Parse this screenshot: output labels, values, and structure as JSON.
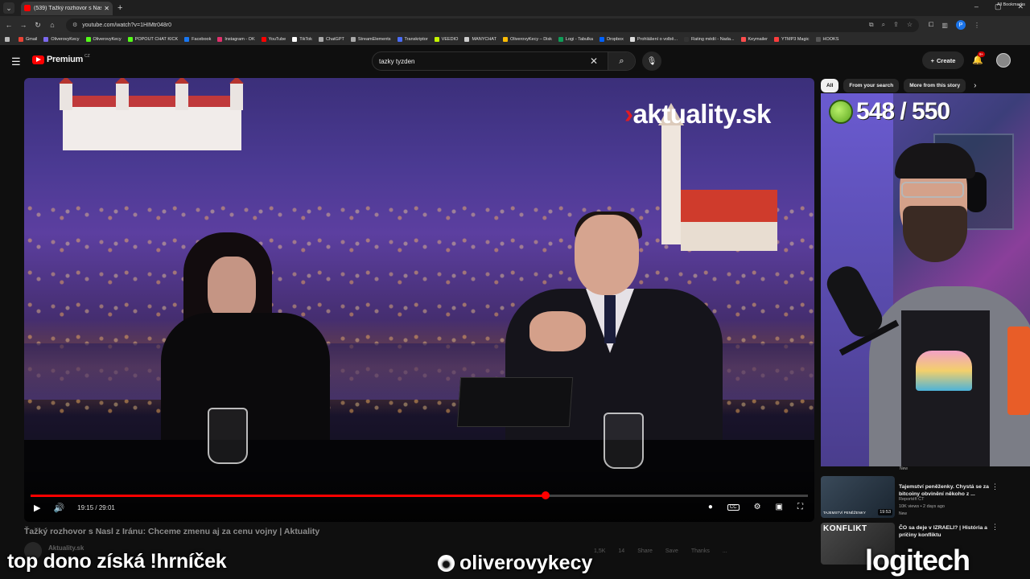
{
  "browser": {
    "tab_title": "(539) Ťažký rozhovor s Nas",
    "url": "youtube.com/watch?v=1HIMtr048r0",
    "profile_initial": "P",
    "bookmarks": [
      {
        "label": "Gmail",
        "color": "#ea4335"
      },
      {
        "label": "OliverovyKecy",
        "color": "#7b68ee"
      },
      {
        "label": "OliverovyKecy",
        "color": "#53fc18"
      },
      {
        "label": "POPOUT CHAT KICK",
        "color": "#53fc18"
      },
      {
        "label": "Facebook",
        "color": "#1877f2"
      },
      {
        "label": "Instagram - OK",
        "color": "#e1306c"
      },
      {
        "label": "YouTube",
        "color": "#ff0000"
      },
      {
        "label": "TikTok",
        "color": "#ffffff"
      },
      {
        "label": "ChatGPT",
        "color": "#aaaaaa"
      },
      {
        "label": "StreamElements",
        "color": "#aaaaaa"
      },
      {
        "label": "Transkriptor",
        "color": "#4a6cf7"
      },
      {
        "label": "VEEDIO",
        "color": "#c4f500"
      },
      {
        "label": "MANYCHAT",
        "color": "#cccccc"
      },
      {
        "label": "OliverovyKecy – Disk",
        "color": "#fbbc04"
      },
      {
        "label": "Logi - Tabulka",
        "color": "#0f9d58"
      },
      {
        "label": "Dropbox",
        "color": "#0061ff"
      },
      {
        "label": "Prohlášení o volbě...",
        "color": "#dddddd"
      },
      {
        "label": "Rating médií - Nada...",
        "color": "#333333"
      },
      {
        "label": "Keymailer",
        "color": "#ff4d4d"
      },
      {
        "label": "YTMP3 Magic",
        "color": "#ff3d3d"
      },
      {
        "label": "HOOKS",
        "color": "#555555"
      }
    ],
    "all_bookmarks": "All Bookmarks"
  },
  "youtube": {
    "logo_text": "Premium",
    "country_code": "CZ",
    "search_query": "tazky tyzden",
    "create_label": "Create",
    "notif_badge": "9+"
  },
  "player": {
    "watermark": "aktuality.sk",
    "time_display": "19:15 / 29:01",
    "progress_fraction": 0.663
  },
  "video": {
    "title": "Ťažký rozhovor s Nasl z Iránu: Chceme zmenu aj za cenu vojny | Aktuality",
    "channel": "Aktuality.sk",
    "actions": [
      "1,5K",
      "14",
      "Share",
      "Save",
      "Thanks",
      "..."
    ]
  },
  "chips": [
    {
      "label": "All",
      "active": true
    },
    {
      "label": "From your search",
      "active": false
    },
    {
      "label": "More from this story",
      "active": false
    }
  ],
  "cam": {
    "counter": "548 / 550"
  },
  "recommendations": [
    {
      "title": "Tajemství peněženky. Chystá se za bitcoiny obvinění někoho z ...",
      "channel": "Reportéři ČT",
      "meta": "10K views • 2 days ago",
      "badge": "New",
      "duration": "19:53",
      "thumb_caption": "TAJEMSTVÍ PENĚŽENKY"
    },
    {
      "title": "ČO sa deje v IZRAELI? | História a príčiny konfliktu",
      "thumb_caption": "KONFLIKT"
    }
  ],
  "overlays": {
    "left_text": "top dono získá !hrníček",
    "mid_text": "oliverovykecy",
    "right_text": "logitech"
  }
}
